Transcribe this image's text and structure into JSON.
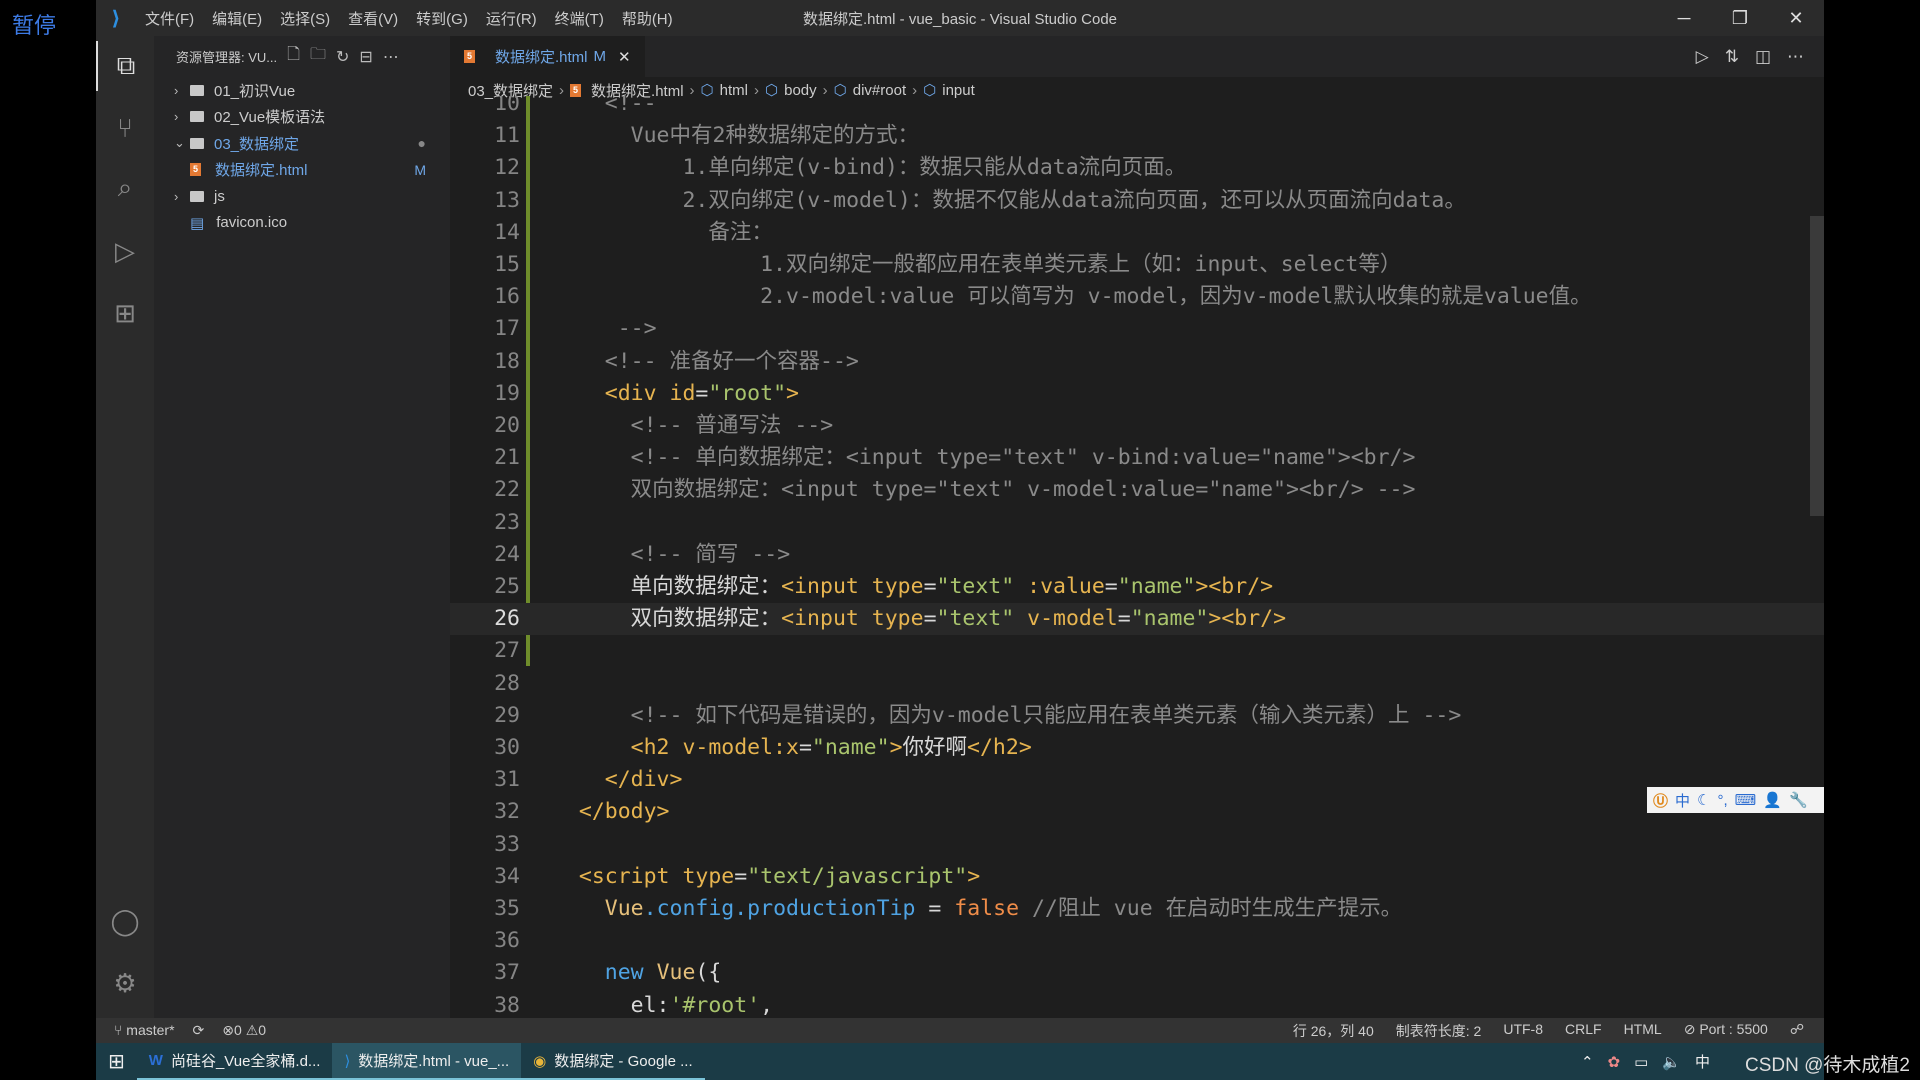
{
  "overlay": {
    "pause": "暂停",
    "watermark": "CSDN @待木成植2"
  },
  "titlebar": {
    "menus": [
      "文件(F)",
      "编辑(E)",
      "选择(S)",
      "查看(V)",
      "转到(G)",
      "运行(R)",
      "终端(T)",
      "帮助(H)"
    ],
    "title": "数据绑定.html - vue_basic - Visual Studio Code",
    "min": "─",
    "restore": "❐",
    "close": "✕"
  },
  "sidebar": {
    "header": "资源管理器: VU...",
    "items": [
      {
        "label": "01_初识Vue",
        "type": "folder",
        "open": false
      },
      {
        "label": "02_Vue模板语法",
        "type": "folder",
        "open": false
      },
      {
        "label": "03_数据绑定",
        "type": "folder",
        "open": true,
        "badge": "●"
      },
      {
        "label": "数据绑定.html",
        "type": "html",
        "badge": "M"
      },
      {
        "label": "js",
        "type": "folder",
        "open": false
      },
      {
        "label": "favicon.ico",
        "type": "file"
      }
    ]
  },
  "tab": {
    "label": "数据绑定.html",
    "modified": "M",
    "close": "✕"
  },
  "breadcrumb": [
    "03_数据绑定",
    "数据绑定.html",
    "html",
    "body",
    "div#root",
    "input"
  ],
  "code": {
    "current_line": 26,
    "lines": [
      {
        "n": 10,
        "t": [
          [
            "    ",
            ""
          ],
          [
            "<!--",
            "c"
          ]
        ]
      },
      {
        "n": 11,
        "t": [
          [
            "      Vue中有2种数据绑定的方式：",
            "c"
          ]
        ]
      },
      {
        "n": 12,
        "t": [
          [
            "          1.单向绑定(v-bind)：数据只能从data流向页面。",
            "c"
          ]
        ]
      },
      {
        "n": 13,
        "t": [
          [
            "          2.双向绑定(v-model)：数据不仅能从data流向页面，还可以从页面流向data。",
            "c"
          ]
        ]
      },
      {
        "n": 14,
        "t": [
          [
            "            备注：",
            "c"
          ]
        ]
      },
      {
        "n": 15,
        "t": [
          [
            "                1.双向绑定一般都应用在表单类元素上（如：input、select等）",
            "c"
          ]
        ]
      },
      {
        "n": 16,
        "t": [
          [
            "                2.v-model:value 可以简写为 v-model，因为v-model默认收集的就是value值。",
            "c"
          ]
        ]
      },
      {
        "n": 17,
        "t": [
          [
            "     -->",
            "c"
          ]
        ]
      },
      {
        "n": 18,
        "t": [
          [
            "    <!-- 准备好一个容器-->",
            "c"
          ]
        ]
      },
      {
        "n": 19,
        "t": [
          [
            "    ",
            ""
          ],
          [
            "<div id",
            "tg"
          ],
          [
            "=",
            "p"
          ],
          [
            "\"root\"",
            "s"
          ],
          [
            ">",
            "tg"
          ]
        ]
      },
      {
        "n": 20,
        "t": [
          [
            "      <!-- 普通写法 -->",
            "c"
          ]
        ]
      },
      {
        "n": 21,
        "t": [
          [
            "      <!-- 单向数据绑定：<input type=\"text\" v-bind:value=\"name\"><br/>",
            "c"
          ]
        ]
      },
      {
        "n": 22,
        "t": [
          [
            "      双向数据绑定：<input type=\"text\" v-model:value=\"name\"><br/> -->",
            "c"
          ]
        ]
      },
      {
        "n": 23,
        "t": []
      },
      {
        "n": 24,
        "t": [
          [
            "      <!-- 简写 -->",
            "c"
          ]
        ]
      },
      {
        "n": 25,
        "t": [
          [
            "      单向数据绑定：",
            "p"
          ],
          [
            "<input type",
            "tg"
          ],
          [
            "=",
            "p"
          ],
          [
            "\"text\"",
            "s"
          ],
          [
            " :value",
            "tg"
          ],
          [
            "=",
            "p"
          ],
          [
            "\"name\"",
            "s"
          ],
          [
            "><br/>",
            "tg"
          ]
        ]
      },
      {
        "n": 26,
        "t": [
          [
            "      双向数据绑定：",
            "p"
          ],
          [
            "<input type",
            "tg"
          ],
          [
            "=",
            "p"
          ],
          [
            "\"text\"",
            "s"
          ],
          [
            " v-model",
            "tg"
          ],
          [
            "=",
            "p"
          ],
          [
            "\"name\"",
            "s"
          ],
          [
            "><br/>",
            "tg"
          ]
        ]
      },
      {
        "n": 27,
        "t": []
      },
      {
        "n": 28,
        "t": []
      },
      {
        "n": 29,
        "t": [
          [
            "      <!-- 如下代码是错误的，因为v-model只能应用在表单类元素（输入类元素）上 -->",
            "c"
          ]
        ]
      },
      {
        "n": 30,
        "t": [
          [
            "      ",
            ""
          ],
          [
            "<h2 v-model:x",
            "tg"
          ],
          [
            "=",
            "p"
          ],
          [
            "\"name\"",
            "s"
          ],
          [
            ">",
            "tg"
          ],
          [
            "你好啊",
            "p"
          ],
          [
            "</h2>",
            "tg"
          ]
        ]
      },
      {
        "n": 31,
        "t": [
          [
            "    ",
            ""
          ],
          [
            "</div>",
            "tg"
          ]
        ]
      },
      {
        "n": 32,
        "t": [
          [
            "  ",
            ""
          ],
          [
            "</body>",
            "tg"
          ]
        ]
      },
      {
        "n": 33,
        "t": []
      },
      {
        "n": 34,
        "t": [
          [
            "  ",
            ""
          ],
          [
            "<script type",
            "tg"
          ],
          [
            "=",
            "p"
          ],
          [
            "\"text/javascript\"",
            "s"
          ],
          [
            ">",
            "tg"
          ]
        ]
      },
      {
        "n": 35,
        "t": [
          [
            "    ",
            ""
          ],
          [
            "Vue",
            "y"
          ],
          [
            ".config.productionTip",
            "k"
          ],
          [
            " = ",
            "p"
          ],
          [
            "false",
            "o"
          ],
          [
            " //阻止 vue 在启动时生成生产提示。",
            "c"
          ]
        ]
      },
      {
        "n": 36,
        "t": []
      },
      {
        "n": 37,
        "t": [
          [
            "    ",
            ""
          ],
          [
            "new",
            "k"
          ],
          [
            " Vue",
            "y"
          ],
          [
            "({",
            "p"
          ]
        ]
      },
      {
        "n": 38,
        "t": [
          [
            "      el:",
            "p"
          ],
          [
            "'#root'",
            "s"
          ],
          [
            ",",
            "p"
          ]
        ]
      }
    ]
  },
  "status": {
    "branch": "master*",
    "errors": "0",
    "warnings": "0",
    "position": "行 26，列 40",
    "tab_size": "制表符长度: 2",
    "encoding": "UTF-8",
    "eol": "CRLF",
    "language": "HTML",
    "port": "Port : 5500"
  },
  "ime": {
    "mode": "中"
  },
  "taskbar": {
    "items": [
      "尚硅谷_Vue全家桶.d...",
      "数据绑定.html - vue_...",
      "数据绑定 - Google ..."
    ],
    "tray_ime": "中"
  }
}
